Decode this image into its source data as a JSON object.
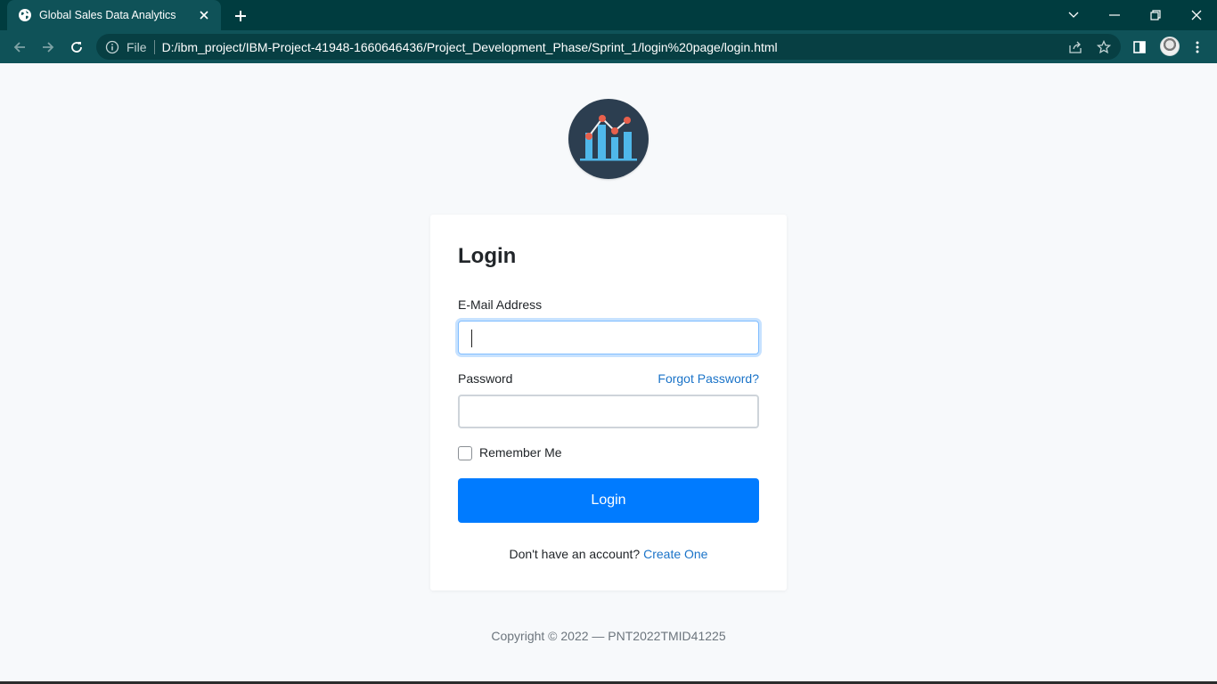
{
  "browser": {
    "tab_title": "Global Sales Data Analytics",
    "omnibox": {
      "scheme_label": "File",
      "url": "D:/ibm_project/IBM-Project-41948-1660646436/Project_Development_Phase/Sprint_1/login%20page/login.html"
    },
    "icons": [
      "globe-icon",
      "close-icon",
      "plus-icon",
      "chevron-down-icon",
      "minimize-icon",
      "restore-icon",
      "close-window-icon",
      "back-arrow-icon",
      "forward-arrow-icon",
      "reload-icon",
      "info-icon",
      "share-icon",
      "star-icon",
      "side-panel-icon",
      "kebab-menu-icon"
    ]
  },
  "colors": {
    "chrome_dark": "#003c3f",
    "chrome_tab": "#0f5258",
    "page_bg": "#f7f9fb",
    "primary": "#007bff",
    "link": "#1a73c8",
    "logo_bg": "#2c3e50",
    "logo_bars": "#4fb8ea",
    "logo_points": "#e8604c"
  },
  "login": {
    "title": "Login",
    "email_label": "E-Mail Address",
    "email_value": "",
    "password_label": "Password",
    "password_value": "",
    "forgot_link": "Forgot Password?",
    "remember_label": "Remember Me",
    "remember_checked": false,
    "submit_label": "Login",
    "signup_prompt": "Don't have an account?",
    "signup_link": "Create One"
  },
  "footer": {
    "copyright": "Copyright © 2022 — PNT2022TMID41225"
  }
}
